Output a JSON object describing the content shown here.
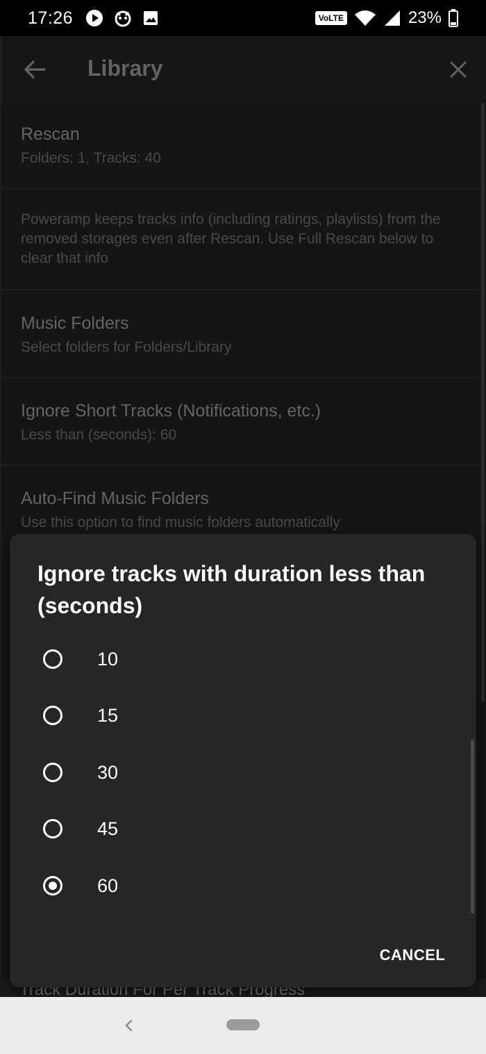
{
  "status_bar": {
    "time": "17:26",
    "network_badge": "VoLTE",
    "battery_percent": "23%",
    "icons": [
      "play-icon",
      "notification-icon",
      "image-icon",
      "wifi-icon",
      "signal-icon",
      "battery-icon"
    ]
  },
  "app_bar": {
    "title": "Library",
    "icons": [
      "back-arrow-icon",
      "close-icon"
    ]
  },
  "settings": [
    {
      "title": "Rescan",
      "subtitle": "Folders: 1, Tracks: 40"
    },
    {
      "note": "Poweramp keeps tracks info (including ratings, playlists) from the removed storages even after Rescan. Use Full Rescan below to clear that info"
    },
    {
      "title": "Music Folders",
      "subtitle": "Select folders for Folders/Library"
    },
    {
      "title": "Ignore Short Tracks (Notifications, etc.)",
      "subtitle": "Less than (seconds): 60"
    },
    {
      "title": "Auto-Find Music Folders",
      "subtitle": "Use this option to find music folders automatically"
    }
  ],
  "partial_item": "Track Duration For Per Track Progress",
  "dialog": {
    "title": "Ignore tracks with duration less than (seconds)",
    "options": [
      {
        "label": "10",
        "selected": false
      },
      {
        "label": "15",
        "selected": false
      },
      {
        "label": "30",
        "selected": false
      },
      {
        "label": "45",
        "selected": false
      },
      {
        "label": "60",
        "selected": true
      }
    ],
    "cancel_label": "CANCEL"
  },
  "nav_bar": {
    "icons": [
      "nav-back-icon",
      "home-pill"
    ]
  },
  "colors": {
    "background": "#1b1b1b",
    "dialog": "#262626",
    "text_primary": "#ffffff",
    "text_dim": "#8b8b8b"
  }
}
